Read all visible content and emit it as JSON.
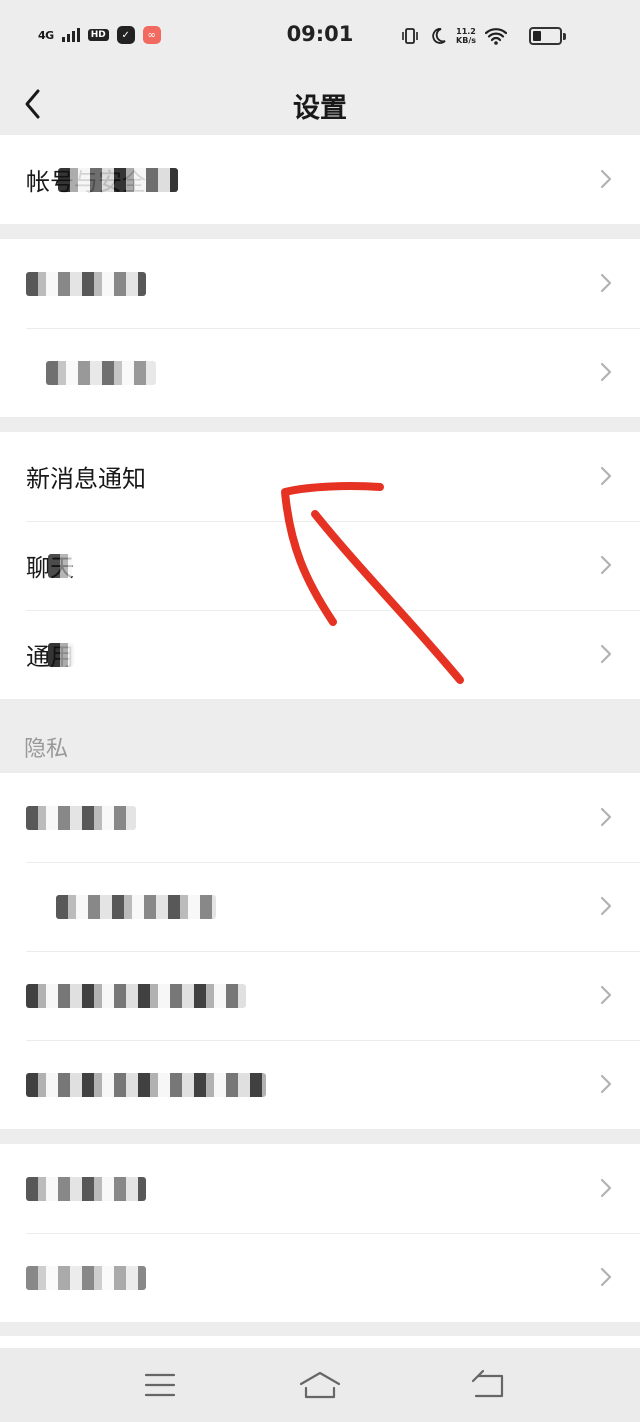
{
  "status_bar": {
    "network": "4G",
    "hd_badge": "HD",
    "time": "09:01",
    "speed_value": "11.2",
    "speed_unit": "KB/s",
    "battery_level": 0.3
  },
  "header": {
    "title": "设置"
  },
  "groups": [
    {
      "items": [
        {
          "label": "帐号与安全",
          "redacted": true
        }
      ]
    },
    {
      "items": [
        {
          "label": "",
          "redacted": true
        },
        {
          "label": "",
          "redacted": true
        }
      ]
    },
    {
      "items": [
        {
          "label": "新消息通知",
          "redacted": false
        },
        {
          "label": "聊天",
          "redacted": true
        },
        {
          "label": "通用",
          "redacted": true
        }
      ]
    },
    {
      "section_label": "隐私",
      "items": [
        {
          "label": "",
          "redacted": true
        },
        {
          "label": "",
          "redacted": true
        },
        {
          "label": "",
          "redacted": true
        },
        {
          "label": "",
          "redacted": true
        }
      ]
    },
    {
      "items": [
        {
          "label": "",
          "redacted": true
        },
        {
          "label": "",
          "redacted": true
        }
      ]
    }
  ],
  "annotation": {
    "color": "#e53222"
  },
  "icons": {
    "back": "chevron-left-icon",
    "row_arrow": "chevron-right-icon",
    "menu": "menu-icon",
    "home": "home-icon",
    "return": "return-icon"
  }
}
